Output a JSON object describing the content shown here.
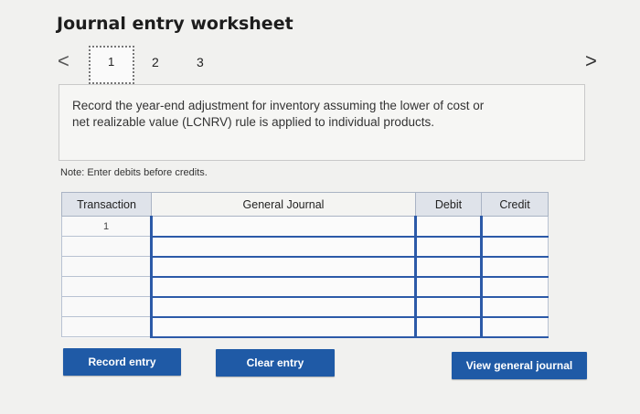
{
  "header": {
    "title": "Journal entry worksheet"
  },
  "nav": {
    "prev": "<",
    "next": ">",
    "steps": [
      "1",
      "2",
      "3"
    ]
  },
  "instruction": {
    "line1": "Record the year-end adjustment for inventory assuming the lower of cost or",
    "line2": "net realizable value (LCNRV) rule is applied to individual products."
  },
  "note": "Note: Enter debits before credits.",
  "table": {
    "headers": {
      "transaction": "Transaction",
      "general_journal": "General Journal",
      "debit": "Debit",
      "credit": "Credit"
    },
    "rows": [
      {
        "transaction": "1"
      },
      {
        "transaction": ""
      },
      {
        "transaction": ""
      },
      {
        "transaction": ""
      },
      {
        "transaction": ""
      },
      {
        "transaction": ""
      }
    ]
  },
  "buttons": {
    "record": "Record entry",
    "clear": "Clear entry",
    "view": "View general journal"
  }
}
